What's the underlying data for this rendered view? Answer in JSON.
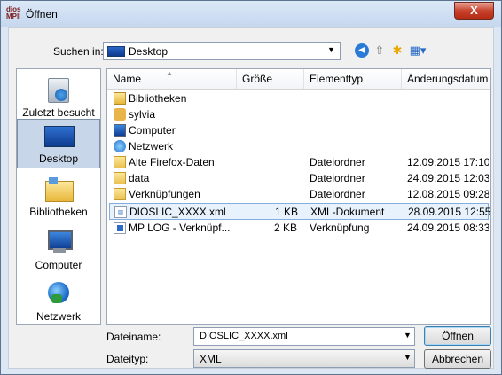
{
  "window": {
    "title": "Öffnen",
    "app_icon_text": [
      "dios",
      "MPII"
    ],
    "close_glyph": "X"
  },
  "toolbar": {
    "lookin_label": "Suchen in:",
    "lookin_value": "Desktop",
    "back_icon": "back-arrow-icon",
    "up_icon": "up-folder-icon",
    "new_folder_icon": "new-folder-icon",
    "view_icon": "view-menu-icon"
  },
  "places": [
    {
      "label": "Zuletzt besucht",
      "icon": "recent-places-icon",
      "selected": false
    },
    {
      "label": "Desktop",
      "icon": "desktop-icon",
      "selected": true
    },
    {
      "label": "Bibliotheken",
      "icon": "libraries-icon",
      "selected": false
    },
    {
      "label": "Computer",
      "icon": "computer-icon",
      "selected": false
    },
    {
      "label": "Netzwerk",
      "icon": "network-icon",
      "selected": false
    }
  ],
  "columns": {
    "name": "Name",
    "size": "Größe",
    "type": "Elementtyp",
    "date": "Änderungsdatum"
  },
  "files": [
    {
      "name": "Bibliotheken",
      "size": "",
      "type": "",
      "date": "",
      "icon": "library-icon"
    },
    {
      "name": "sylvia",
      "size": "",
      "type": "",
      "date": "",
      "icon": "user-folder-icon"
    },
    {
      "name": "Computer",
      "size": "",
      "type": "",
      "date": "",
      "icon": "computer-icon"
    },
    {
      "name": "Netzwerk",
      "size": "",
      "type": "",
      "date": "",
      "icon": "network-icon"
    },
    {
      "name": "Alte Firefox-Daten",
      "size": "",
      "type": "Dateiordner",
      "date": "12.09.2015 17:10",
      "icon": "folder-icon"
    },
    {
      "name": "data",
      "size": "",
      "type": "Dateiordner",
      "date": "24.09.2015 12:03",
      "icon": "folder-icon"
    },
    {
      "name": "Verknüpfungen",
      "size": "",
      "type": "Dateiordner",
      "date": "12.08.2015 09:28",
      "icon": "folder-icon"
    },
    {
      "name": "DIOSLIC_XXXX.xml",
      "size": "1 KB",
      "type": "XML-Dokument",
      "date": "28.09.2015 12:55",
      "icon": "xml-file-icon",
      "selected": true
    },
    {
      "name": "MP LOG - Verknüpf...",
      "size": "2 KB",
      "type": "Verknüpfung",
      "date": "24.09.2015 08:33",
      "icon": "shortcut-icon"
    }
  ],
  "filename": {
    "label": "Dateiname:",
    "value": "DIOSLIC_XXXX.xml"
  },
  "filetype": {
    "label": "Dateityp:",
    "value": "XML"
  },
  "buttons": {
    "open": "Öffnen",
    "cancel": "Abbrechen"
  }
}
